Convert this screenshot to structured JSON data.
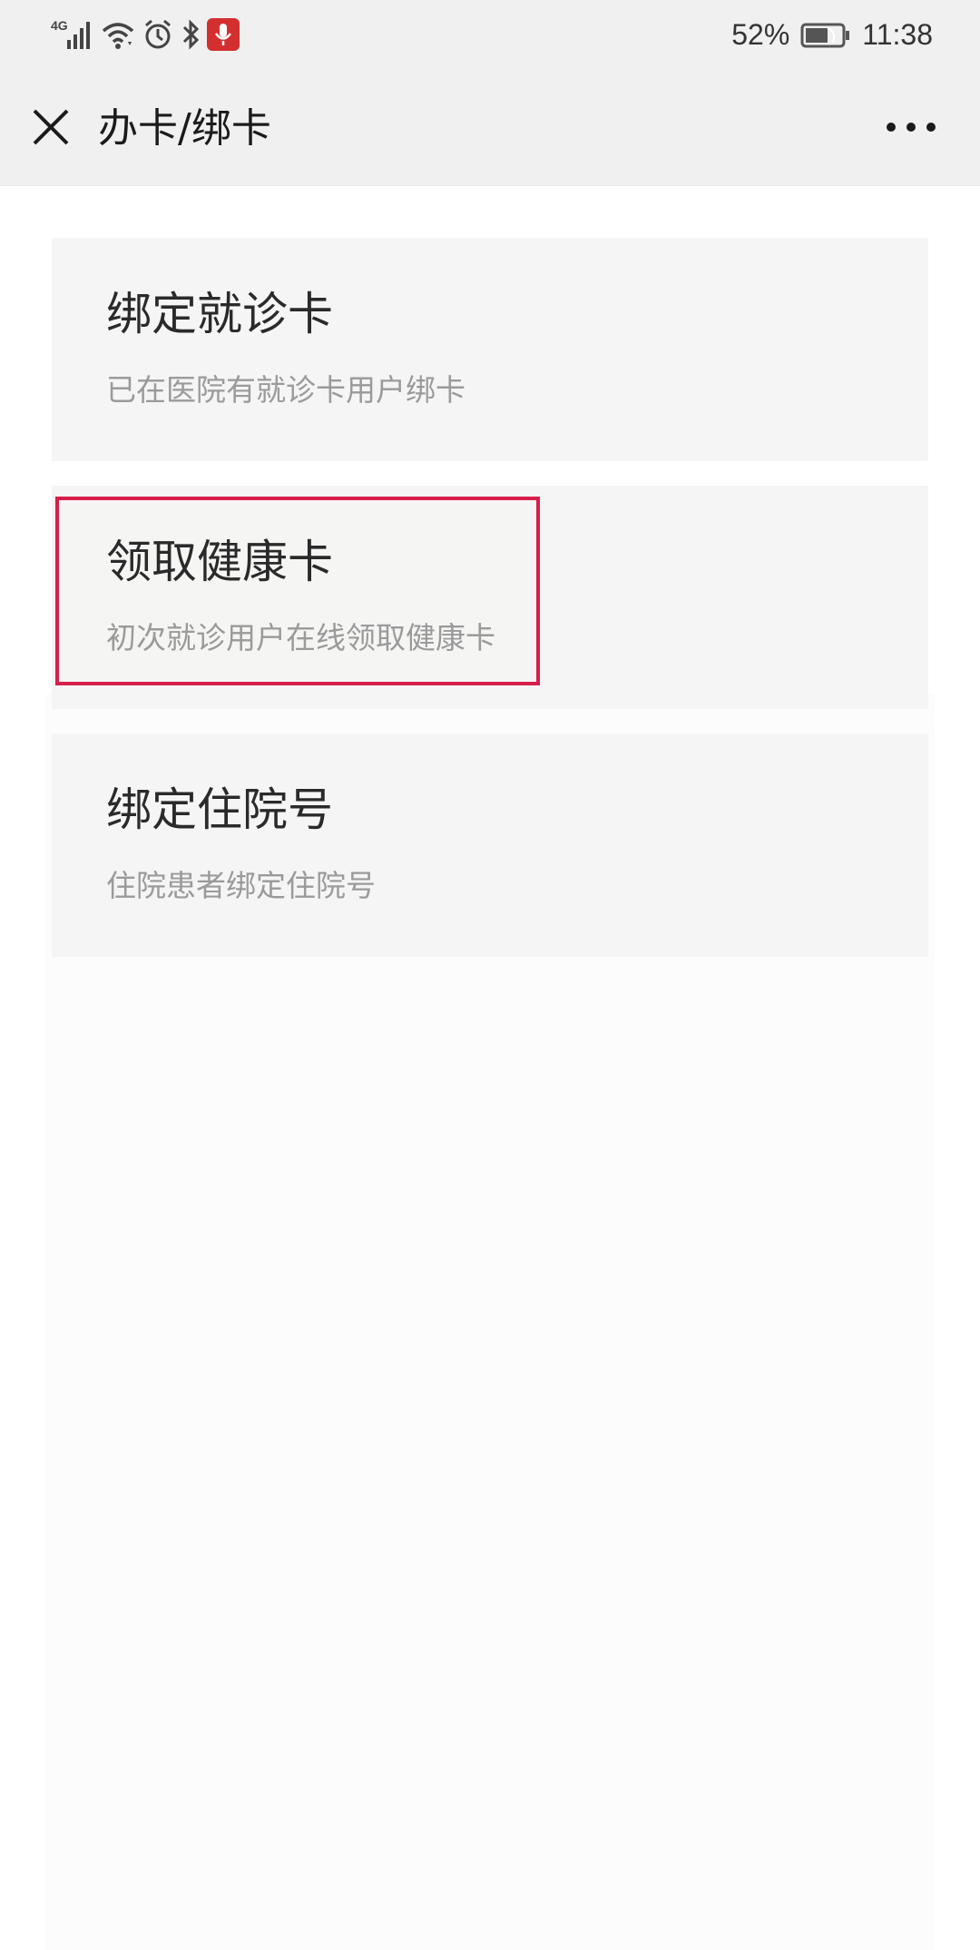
{
  "status_bar": {
    "network": "4G",
    "battery": "52%",
    "time": "11:38"
  },
  "navbar": {
    "title": "办卡/绑卡"
  },
  "cards": [
    {
      "title": "绑定就诊卡",
      "subtitle": "已在医院有就诊卡用户绑卡"
    },
    {
      "title": "领取健康卡",
      "subtitle": "初次就诊用户在线领取健康卡",
      "highlighted": true
    },
    {
      "title": "绑定住院号",
      "subtitle": "住院患者绑定住院号"
    }
  ],
  "colors": {
    "highlight_border": "#d81e4a",
    "mic_indicator": "#d32f2f"
  }
}
